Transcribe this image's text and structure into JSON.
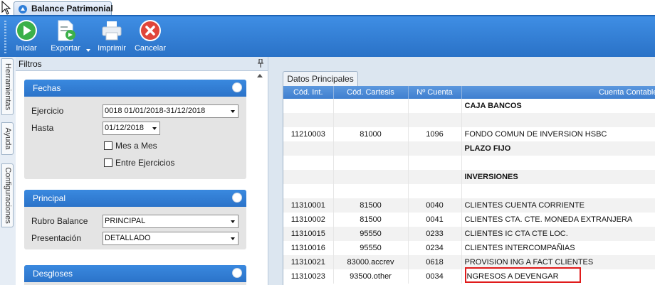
{
  "window": {
    "tab_title": "Balance Patrimonial"
  },
  "toolbar": {
    "buttons": [
      {
        "label": "Iniciar",
        "icon": "play-icon",
        "color": "#3bb04a"
      },
      {
        "label": "Exportar",
        "icon": "export-icon",
        "color": "#1e7fd0"
      },
      {
        "label": "Imprimir",
        "icon": "printer-icon",
        "color": "#e9eef4"
      },
      {
        "label": "Cancelar",
        "icon": "cancel-icon",
        "color": "#e0453a"
      }
    ]
  },
  "side_tabs": [
    "Herramientas",
    "Ayuda",
    "Configuraciones"
  ],
  "filtros": {
    "title": "Filtros",
    "fechas": {
      "title": "Fechas",
      "ejercicio_label": "Ejercicio",
      "ejercicio_value": "0018 01/01/2018-31/12/2018",
      "hasta_label": "Hasta",
      "hasta_value": "01/12/2018",
      "mes_a_mes_label": "Mes a Mes",
      "entre_ejercicios_label": "Entre Ejercicios"
    },
    "principal": {
      "title": "Principal",
      "rubro_label": "Rubro Balance",
      "rubro_value": "PRINCIPAL",
      "presentacion_label": "Presentación",
      "presentacion_value": "DETALLADO"
    },
    "desgloses": {
      "title": "Desgloses"
    }
  },
  "grid": {
    "tab_label": "Datos Principales",
    "columns": [
      "Cód. Int.",
      "Cód. Cartesis",
      "Nº Cuenta",
      "Cuenta Contable"
    ],
    "rows": [
      [
        "",
        "",
        "",
        "CAJA BANCOS"
      ],
      [
        "",
        "",
        "",
        ""
      ],
      [
        "11210003",
        "81000",
        "1096",
        "FONDO COMUN DE INVERSION HSBC"
      ],
      [
        "",
        "",
        "",
        "PLAZO FIJO"
      ],
      [
        "",
        "",
        "",
        ""
      ],
      [
        "",
        "",
        "",
        "INVERSIONES"
      ],
      [
        "",
        "",
        "",
        ""
      ],
      [
        "11310001",
        "81500",
        "0040",
        "CLIENTES CUENTA CORRIENTE"
      ],
      [
        "11310002",
        "81500",
        "0041",
        "CLIENTES CTA. CTE. MONEDA EXTRANJERA"
      ],
      [
        "11310015",
        "95550",
        "0233",
        "CLIENTES IC CTA CTE LOC."
      ],
      [
        "11310016",
        "95550",
        "0234",
        "CLIENTES INTERCOMPAÑIAS"
      ],
      [
        "11310021",
        "83000.accrev",
        "0618",
        "PROVISION ING A FACT CLIENTES"
      ],
      [
        "11310023",
        "93500.other",
        "0034",
        "INGRESOS A DEVENGAR"
      ]
    ],
    "bold_rows": [
      0,
      3,
      5
    ],
    "highlight_color": "#e01b1b"
  }
}
